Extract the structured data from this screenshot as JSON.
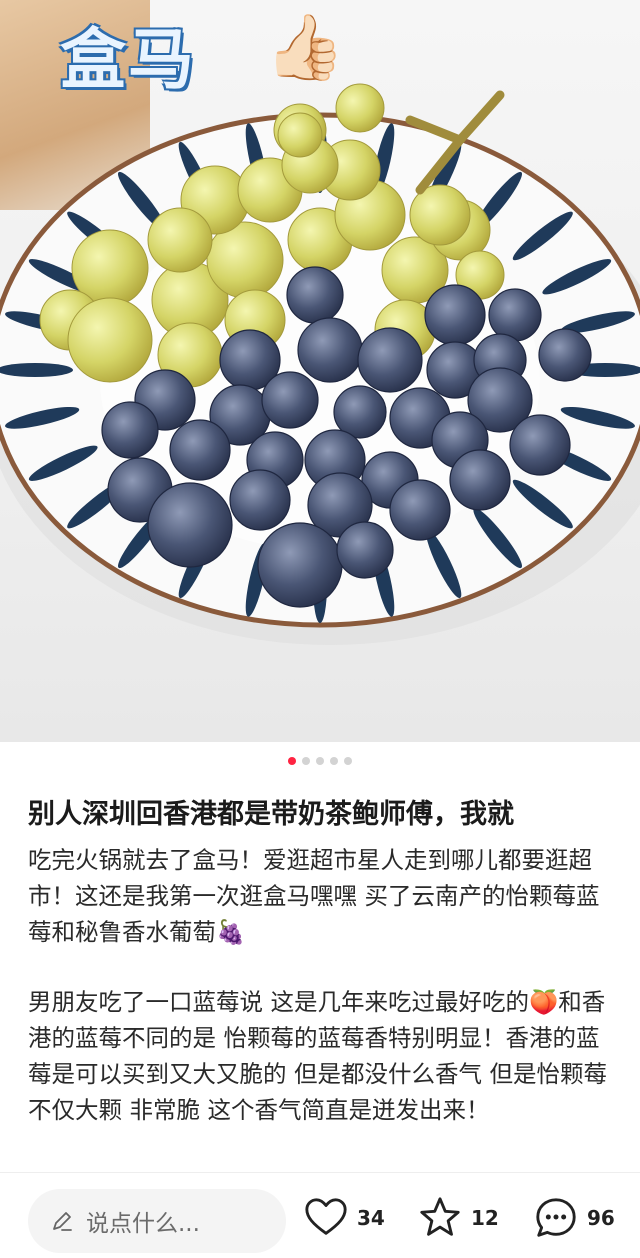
{
  "photo": {
    "overlay_text": "盒马",
    "overlay_emoji": "👍🏻",
    "carousel": {
      "total": 5,
      "active": 0
    }
  },
  "post": {
    "title": "别人深圳回香港都是带奶茶鲍师傅，我就",
    "paragraph1": "吃完火锅就去了盒马！爱逛超市星人走到哪儿都要逛超市！这还是我第一次逛盒马嘿嘿 买了云南产的怡颗莓蓝莓和秘鲁香水葡萄🍇",
    "paragraph2": "男朋友吃了一口蓝莓说 这是几年来吃过最好吃的🍑和香港的蓝莓不同的是 怡颗莓的蓝莓香特别明显！香港的蓝莓是可以买到又大又脆的 但是都没什么香气 但是怡颗莓不仅大颗 非常脆 这个香气简直是迸发出来！"
  },
  "bottom_bar": {
    "comment_placeholder": "说点什么...",
    "likes": "34",
    "favorites": "12",
    "comments": "96"
  },
  "colors": {
    "accent": "#ff2442",
    "dot_inactive": "#d3d3d3",
    "text": "#222222"
  }
}
